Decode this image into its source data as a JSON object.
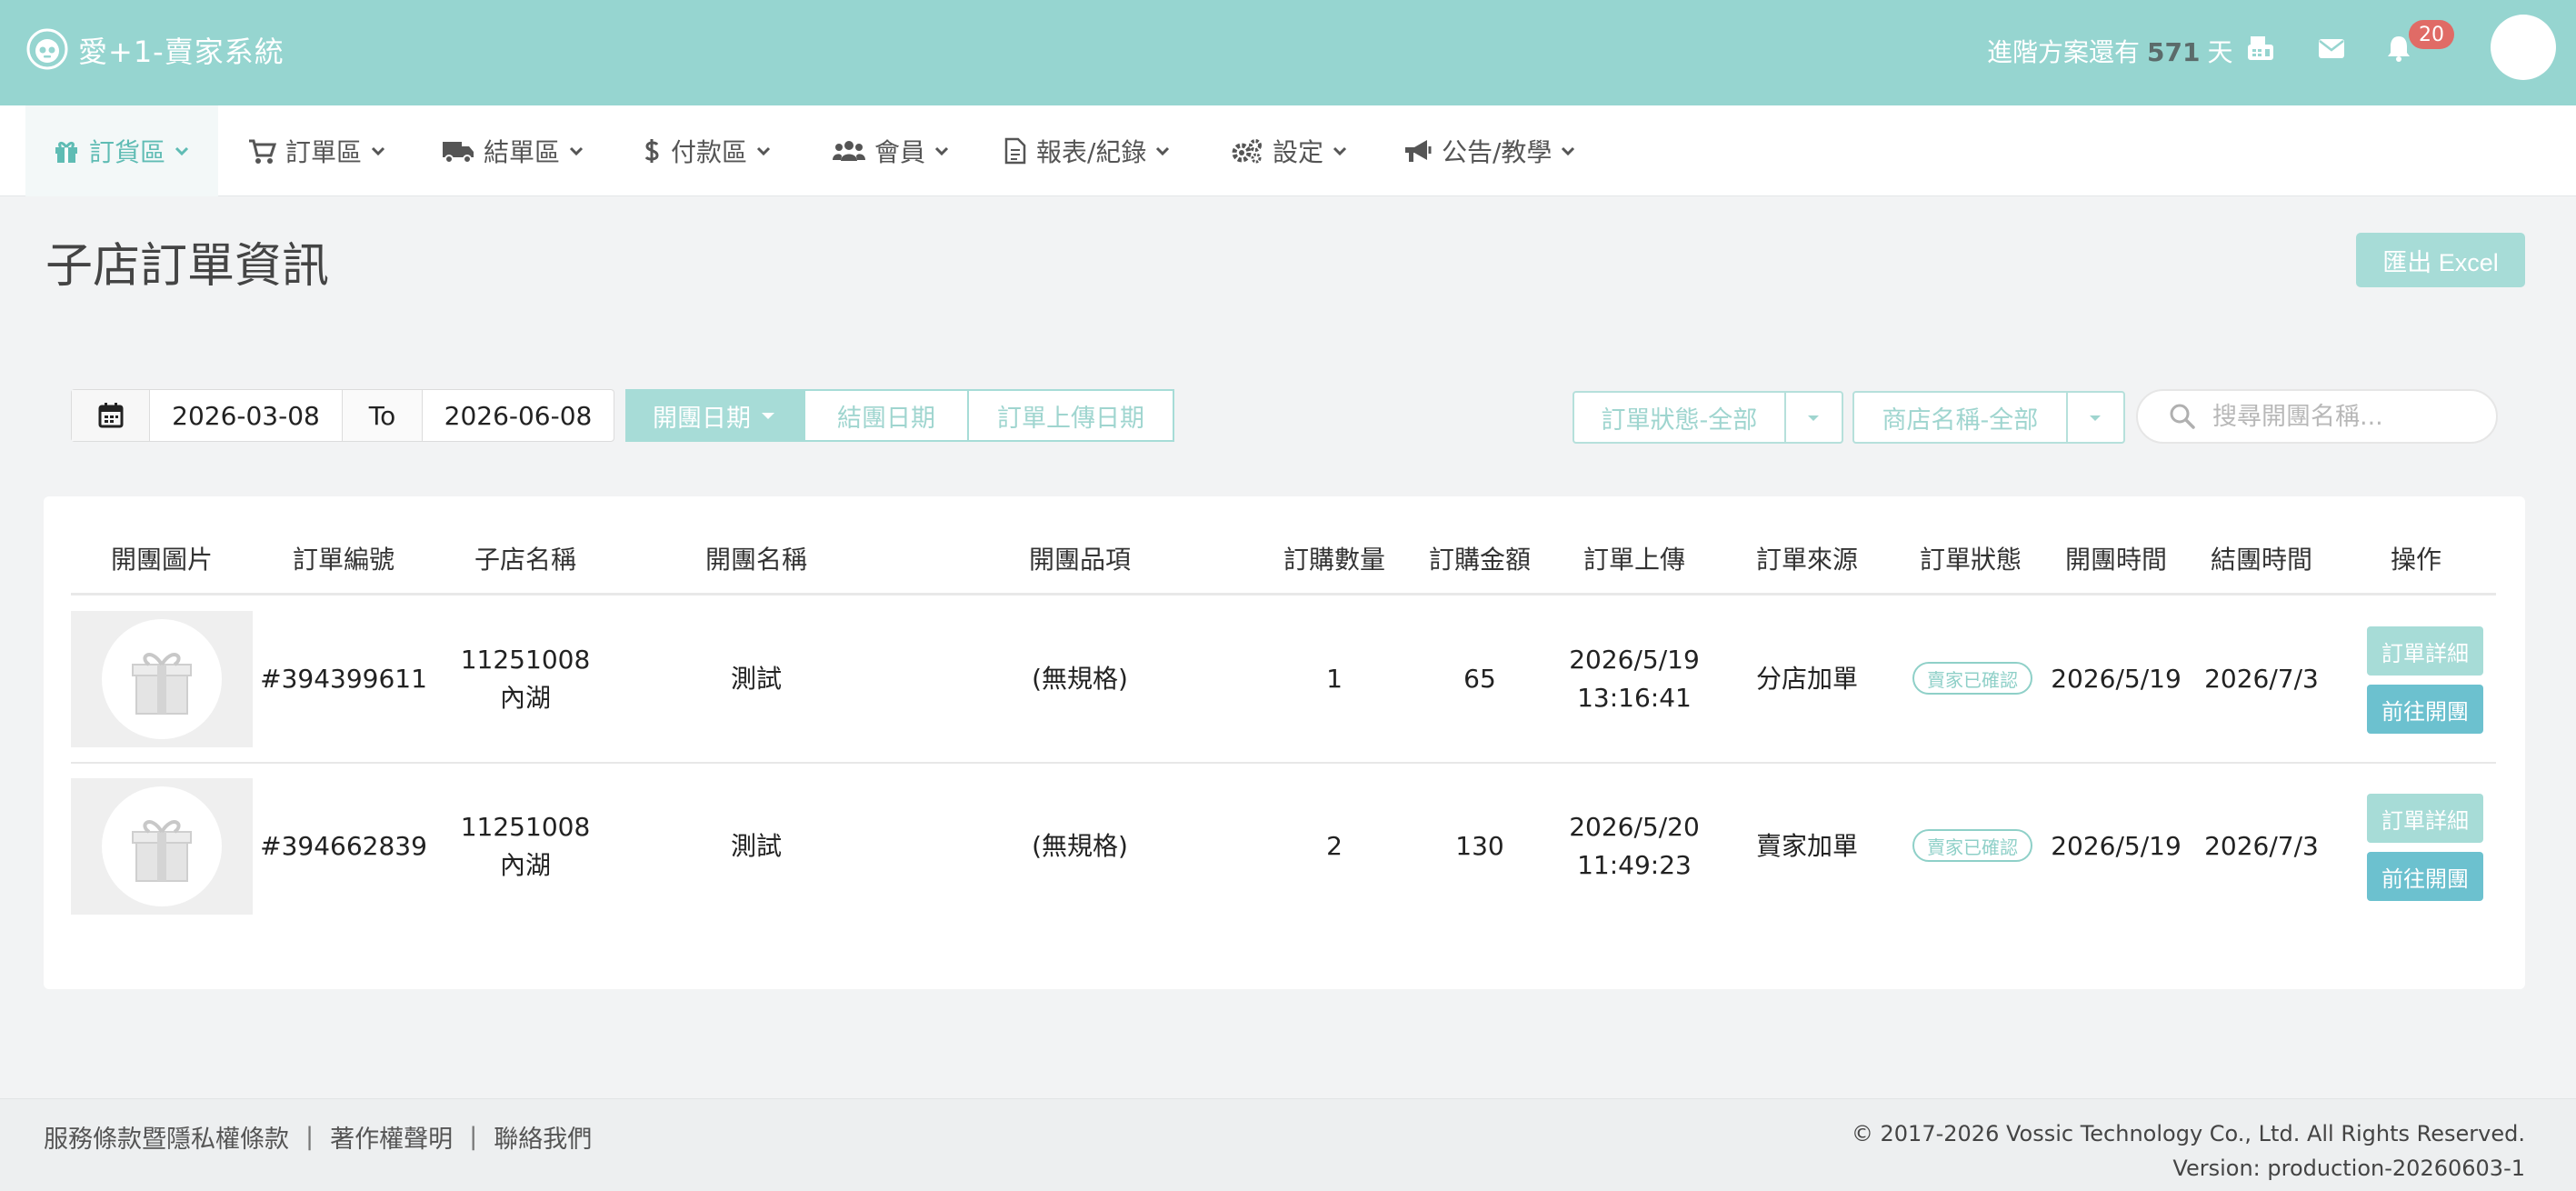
{
  "app": {
    "brand": "愛+1-賣家系統"
  },
  "topbar": {
    "plan_prefix": "進階方案還有",
    "plan_days": "571",
    "plan_suffix": "天",
    "notification_count": "20"
  },
  "nav": [
    {
      "label": "訂貨區",
      "icon": "gift-icon"
    },
    {
      "label": "訂單區",
      "icon": "cart-icon"
    },
    {
      "label": "結單區",
      "icon": "truck-icon"
    },
    {
      "label": "付款區",
      "icon": "dollar-icon"
    },
    {
      "label": "會員",
      "icon": "users-icon"
    },
    {
      "label": "報表/紀錄",
      "icon": "document-icon"
    },
    {
      "label": "設定",
      "icon": "gears-icon"
    },
    {
      "label": "公告/教學",
      "icon": "megaphone-icon"
    }
  ],
  "page": {
    "title": "子店訂單資訊",
    "export_label": "匯出 Excel"
  },
  "filters": {
    "start_date": "2026-03-08",
    "to_label": "To",
    "end_date": "2026-06-08",
    "date_types": [
      "開團日期",
      "結團日期",
      "訂單上傳日期"
    ],
    "order_status": "訂單狀態-全部",
    "store_name": "商店名稱-全部",
    "search_placeholder": "搜尋開團名稱..."
  },
  "table": {
    "columns": [
      "開團圖片",
      "訂單編號",
      "子店名稱",
      "開團名稱",
      "開團品項",
      "訂購數量",
      "訂購金額",
      "訂單上傳",
      "訂單來源",
      "訂單狀態",
      "開團時間",
      "結團時間",
      "操作"
    ],
    "rows": [
      {
        "order_id": "#394399611",
        "store_code": "11251008",
        "store_name": "內湖",
        "group_name": "測試",
        "item": "(無規格)",
        "qty": "1",
        "amount": "65",
        "upload_date": "2026/5/19",
        "upload_time": "13:16:41",
        "source": "分店加單",
        "status": "賣家已確認",
        "open_time": "2026/5/19",
        "close_time": "2026/7/3",
        "detail_label": "訂單詳細",
        "go_label": "前往開團"
      },
      {
        "order_id": "#394662839",
        "store_code": "11251008",
        "store_name": "內湖",
        "group_name": "測試",
        "item": "(無規格)",
        "qty": "2",
        "amount": "130",
        "upload_date": "2026/5/20",
        "upload_time": "11:49:23",
        "source": "賣家加單",
        "status": "賣家已確認",
        "open_time": "2026/5/19",
        "close_time": "2026/7/3",
        "detail_label": "訂單詳細",
        "go_label": "前往開團"
      }
    ]
  },
  "footer": {
    "links": [
      "服務條款暨隱私權條款",
      "著作權聲明",
      "聯絡我們"
    ],
    "separator": "|",
    "copyright": "© 2017-2026 Vossic Technology Co., Ltd. All Rights Reserved.",
    "version": "Version: production-20260603-1"
  },
  "colors": {
    "topbar": "#96d5d0",
    "accent": "#a7dcd7",
    "accent_text": "#5fbcb4",
    "go_button": "#6cc1cf",
    "badge": "#e06b66"
  }
}
